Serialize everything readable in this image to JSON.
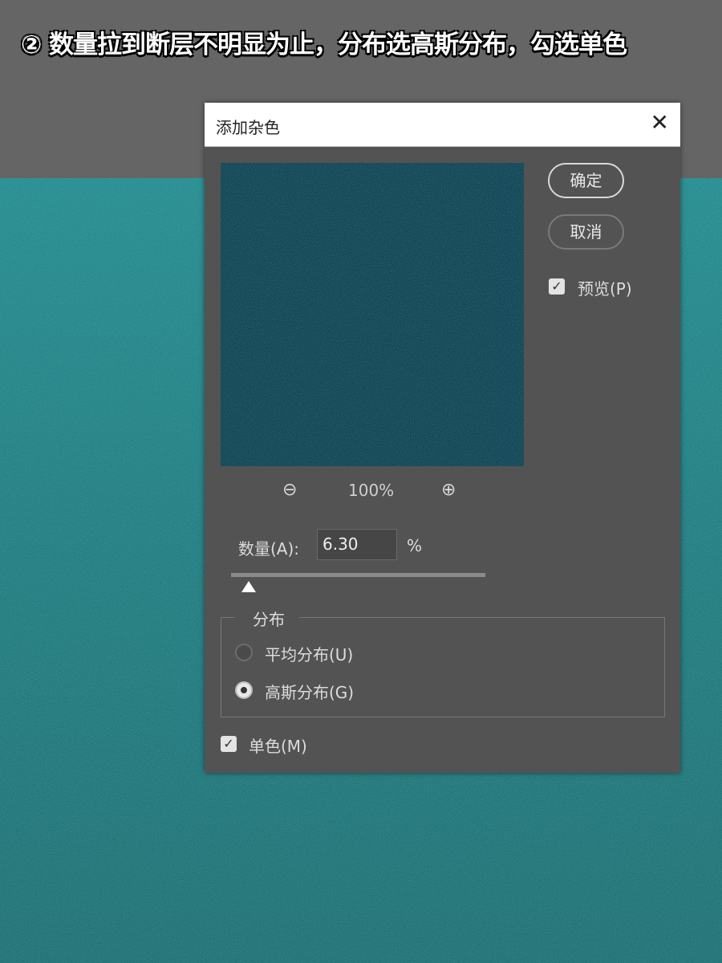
{
  "caption": "② 数量拉到断层不明显为止，分布选高斯分布，勾选单色",
  "dialog": {
    "title": "添加杂色",
    "ok_label": "确定",
    "cancel_label": "取消",
    "preview_label": "预览(P)",
    "preview_checked": true,
    "zoom_level": "100%",
    "amount_label": "数量(A):",
    "amount_value": "6.30",
    "amount_unit": "%",
    "distribution_label": "分布",
    "uniform_label": "平均分布(U)",
    "gaussian_label": "高斯分布(G)",
    "selected_distribution": "gaussian",
    "monochrome_label": "单色(M)",
    "monochrome_checked": true
  },
  "colors": {
    "canvas": "#0d7a7e",
    "dialog": "#535353",
    "preview": "#0f3f4d"
  }
}
